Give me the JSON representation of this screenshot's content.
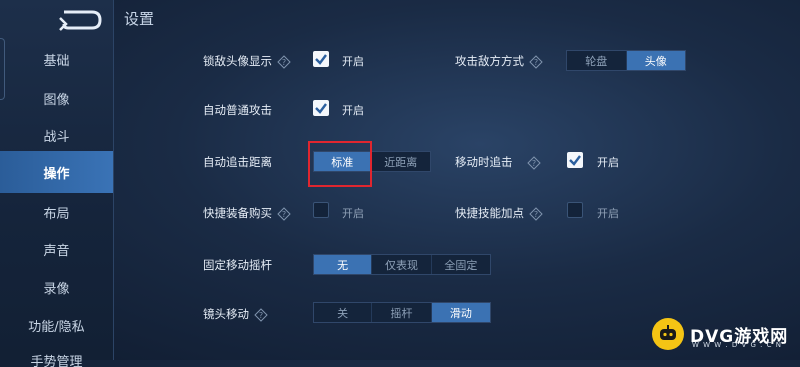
{
  "page": {
    "title": "设置"
  },
  "sidebar": {
    "items": [
      {
        "label": "基础"
      },
      {
        "label": "图像"
      },
      {
        "label": "战斗"
      },
      {
        "label": "操作"
      },
      {
        "label": "布局"
      },
      {
        "label": "声音"
      },
      {
        "label": "录像"
      },
      {
        "label": "功能/隐私"
      },
      {
        "label": "手势管理"
      }
    ]
  },
  "settings": {
    "lock_enemy_avatar": {
      "label": "锁敌头像显示",
      "value": "开启",
      "checked": true
    },
    "attack_mode": {
      "label": "攻击敌方方式",
      "options": [
        "轮盘",
        "头像"
      ],
      "selected": "头像"
    },
    "auto_attack": {
      "label": "自动普通攻击",
      "value": "开启",
      "checked": true
    },
    "auto_chase_distance": {
      "label": "自动追击距离",
      "options": [
        "标准",
        "近距离"
      ],
      "selected": "标准"
    },
    "chase_while_moving": {
      "label": "移动时追击",
      "value": "开启",
      "checked": true
    },
    "quick_buy": {
      "label": "快捷装备购买",
      "value": "开启",
      "checked": false
    },
    "quick_skill": {
      "label": "快捷技能加点",
      "value": "开启",
      "checked": false
    },
    "fixed_joystick": {
      "label": "固定移动摇杆",
      "options": [
        "无",
        "仅表现",
        "全固定"
      ],
      "selected": "无"
    },
    "camera_move": {
      "label": "镜头移动",
      "options": [
        "关",
        "摇杆",
        "滑动"
      ],
      "selected": "滑动"
    }
  },
  "watermark": {
    "text": "DVG游戏网",
    "sub": "W W W . D V G . C N"
  },
  "colors": {
    "accent": "#3b72b3",
    "highlight": "#e0262f",
    "logo": "#f4c414"
  }
}
